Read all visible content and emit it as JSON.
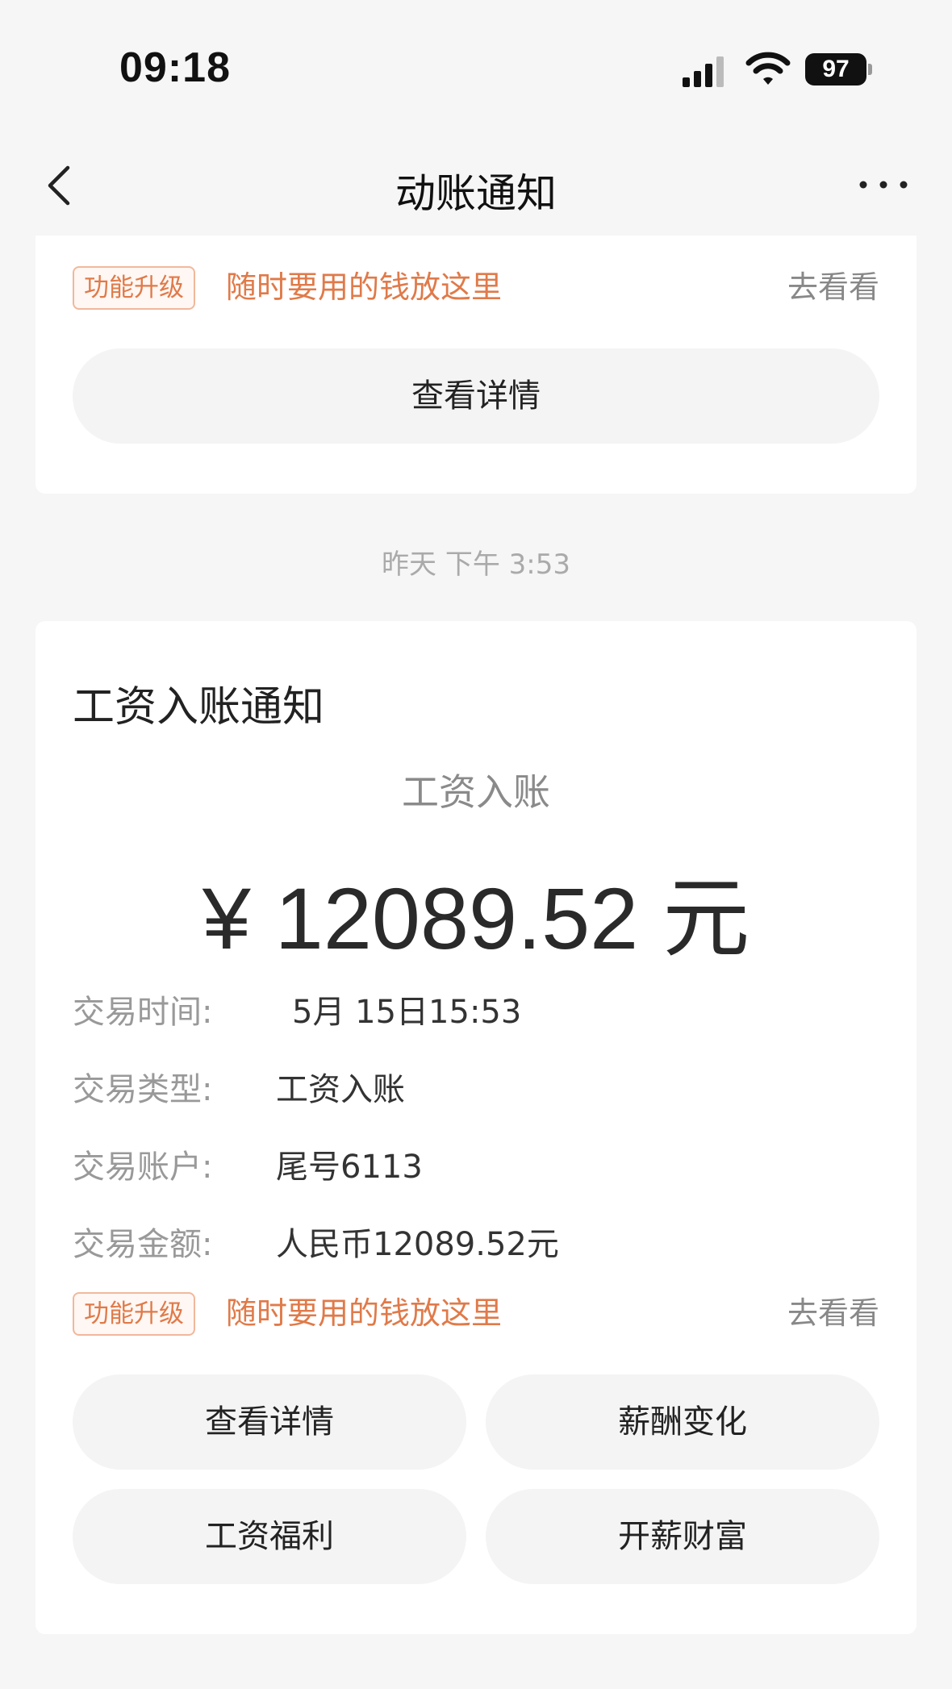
{
  "status_bar": {
    "time": "09:18",
    "battery": "97"
  },
  "nav": {
    "title": "动账通知"
  },
  "top_card": {
    "promo": {
      "badge": "功能升级",
      "text": "随时要用的钱放这里",
      "link": "去看看"
    },
    "button": "查看详情"
  },
  "timestamp": "昨天 下午 3:53",
  "main_card": {
    "title": "工资入账通知",
    "subtitle": "工资入账",
    "amount": "¥ 12089.52 元",
    "details": [
      {
        "label": "交易时间:",
        "value": "5月 15日15:53"
      },
      {
        "label": "交易类型:",
        "value": "工资入账"
      },
      {
        "label": "交易账户:",
        "value": "尾号6113"
      },
      {
        "label": "交易金额:",
        "value": "人民币12089.52元"
      }
    ],
    "promo": {
      "badge": "功能升级",
      "text": "随时要用的钱放这里",
      "link": "去看看"
    },
    "buttons": [
      "查看详情",
      "薪酬变化",
      "工资福利",
      "开薪财富"
    ]
  },
  "colors": {
    "accent": "#e07a49",
    "background": "#f6f6f6",
    "card": "#ffffff",
    "button": "#f4f4f4"
  }
}
